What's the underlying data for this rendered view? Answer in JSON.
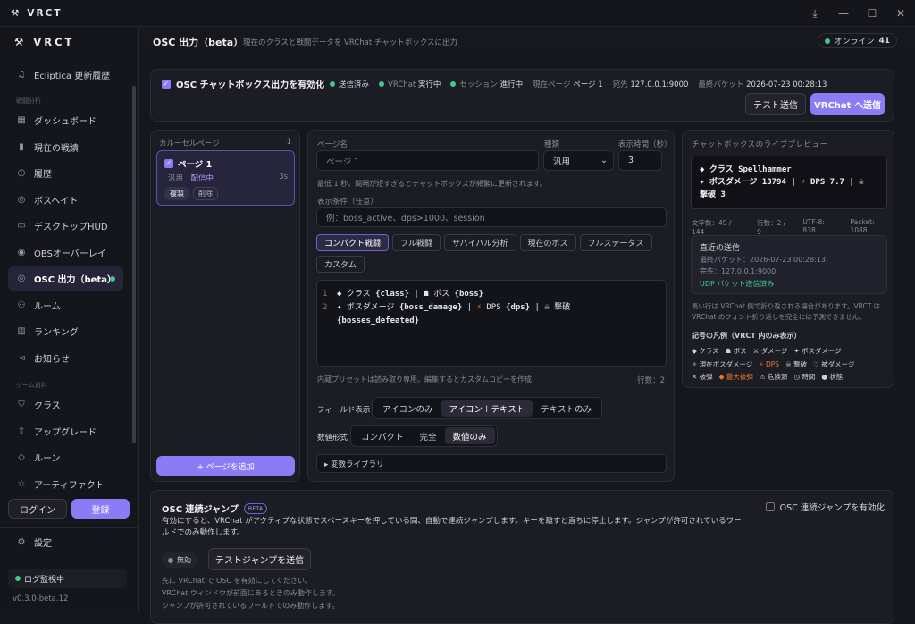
{
  "titlebar": {
    "app_name": "VRCT"
  },
  "sidebar": {
    "brand": "VRCT",
    "history_item": "Ecliptica 更新履歴",
    "section_battle": "戦闘分析",
    "items": [
      "ダッシュボード",
      "現在の戦績",
      "履歴",
      "ボスヘイト",
      "デスクトップHUD",
      "OBSオーバーレイ",
      "OSC 出力（beta）",
      "ルーム",
      "ランキング",
      "お知らせ"
    ],
    "section_game": "ゲーム資料",
    "game_items": [
      "クラス",
      "アップグレード",
      "ルーン",
      "アーティファクト"
    ],
    "login": "ログイン",
    "register": "登録",
    "settings": "設定",
    "log_status": "ログ監視中",
    "version": "v0.3.0-beta.12"
  },
  "header": {
    "title": "OSC 出力（beta）",
    "subtitle": "現在のクラスと戦闘データを VRChat チャットボックスに出力",
    "online_label": "オンライン",
    "online_count": "41"
  },
  "status": {
    "enable_label": "OSC チャットボックス出力を有効化",
    "sent": "送信済み",
    "vrchat_label": "VRChat",
    "vrchat_value": "実行中",
    "session_label": "セッション",
    "session_value": "進行中",
    "page_label": "現在ページ",
    "page_value": "ページ 1",
    "dest_label": "宛先",
    "dest_value": "127.0.0.1:9000",
    "last_label": "最終パケット",
    "last_value": "2026-07-23 00:28:13",
    "test_send": "テスト送信",
    "send_vrchat": "VRChat へ送信"
  },
  "carousel": {
    "title": "カルーセルページ",
    "count": "1",
    "page_name": "ページ 1",
    "page_type": "汎用",
    "page_state": "配信中",
    "page_duration": "3s",
    "duplicate": "複製",
    "delete": "削除",
    "add_page": "+ ページを追加"
  },
  "editor": {
    "name_label": "ページ名",
    "name_placeholder": "ページ 1",
    "type_label": "種類",
    "type_value": "汎用",
    "duration_label": "表示時間（秒）",
    "duration_value": "3",
    "hint": "最低 1 秒。間隔が短すぎるとチャットボックスが頻繁に更新されます。",
    "cond_label": "表示条件（任意）",
    "cond_placeholder": "例：boss_active、dps>1000、session",
    "presets": [
      "コンパクト戦闘",
      "フル戦闘",
      "サバイバル分析",
      "現在のボス",
      "フルステータス",
      "カスタム"
    ],
    "lines": [
      [
        {
          "t": "◆ クラス "
        },
        {
          "t": "{class}",
          "b": true
        },
        {
          "t": " | ☗ ボス "
        },
        {
          "t": "{boss}",
          "b": true
        }
      ],
      [
        {
          "t": "✦ ボスダメージ "
        },
        {
          "t": "{boss_damage}",
          "b": true
        },
        {
          "t": " | "
        },
        {
          "t": "⚡",
          "c": "#f07a2a"
        },
        {
          "t": " DPS "
        },
        {
          "t": "{dps}",
          "b": true
        },
        {
          "t": " | ☠ 撃破"
        }
      ],
      [
        {
          "t": "{bosses_defeated}",
          "b": true
        }
      ]
    ],
    "note": "内蔵プリセットは読み取り専用。編集するとカスタムコピーを作成",
    "row_count": "行数：2",
    "field_label": "フィールド表示",
    "field_opts": [
      "アイコンのみ",
      "アイコン＋テキスト",
      "テキストのみ"
    ],
    "num_label": "数値形式",
    "num_opts": [
      "コンパクト",
      "完全",
      "数値のみ"
    ],
    "var_lib": "▸ 変数ライブラリ"
  },
  "preview": {
    "title": "チャットボックスのライブプレビュー",
    "lines": [
      [
        {
          "t": "◆ クラス Spellhammer"
        }
      ],
      [
        {
          "t": "✦ ボスダメージ 13794 | "
        },
        {
          "t": "⚡",
          "c": "#f07a2a"
        },
        {
          "t": " DPS 7.7 | ☠"
        }
      ],
      [
        {
          "t": "撃破 3"
        }
      ]
    ],
    "stats": [
      "文字数：49 / 144",
      "行数：2 / 9",
      "UTF-8: 838",
      "Packet: 1088"
    ],
    "recent_title": "直近の送信",
    "recent_time": "最終パケット：2026-07-23 00:28:13",
    "recent_dest": "完先：127.0.0.1:9000",
    "recent_status": "UDP パケット送信済み",
    "wrap_note": "長い行は VRChat 側で折り返される場合があります。VRCT は VRChat のフォント折り返しを完全には予測できません。",
    "legend_title": "記号の凡例（VRCT 内のみ表示）",
    "legend": [
      [
        "◆ クラス",
        "☗ ボス",
        "⚔ ダメージ",
        "✦ ボスダメージ"
      ],
      [
        "✧ 現在ボスダメージ",
        "⚡ DPS",
        "☠ 撃破",
        "♡ 被ダメージ"
      ],
      [
        "✕ 被弾",
        "◆ 最大被弾",
        "⚠ 危険源",
        "◷ 時間",
        "● 状態"
      ]
    ],
    "accent": "#f07a2a"
  },
  "jump": {
    "title": "OSC 連続ジャンプ",
    "badge": "BETA",
    "enable": "OSC 連続ジャンプを有効化",
    "desc": "有効にすると、VRChat がアクティブな状態でスペースキーを押している間、自動で連続ジャンプします。キーを離すと直ちに停止します。ジャンプが許可されているワールドでのみ動作します。",
    "state": "無効",
    "test": "テストジャンプを送信",
    "notes": [
      "先に VRChat で OSC を有効にしてください。",
      "VRChat ウィンドウが前面にあるときのみ動作します。",
      "ジャンプが許可されているワールドでのみ動作します。"
    ]
  }
}
